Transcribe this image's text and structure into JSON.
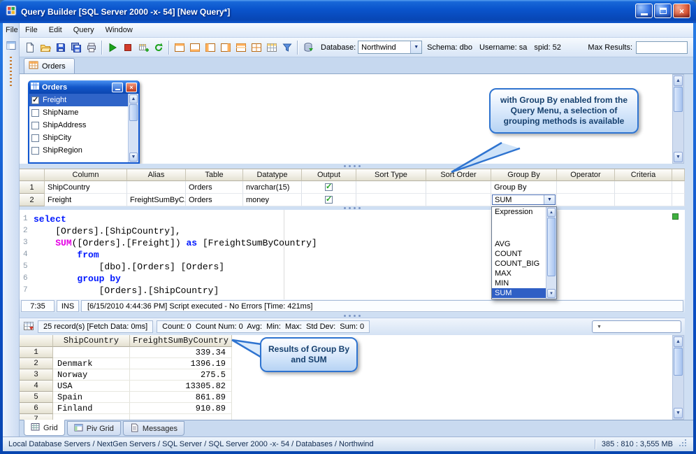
{
  "window": {
    "title": "Query Builder [SQL Server 2000 -x- 54] [New Query*]"
  },
  "parent_menu": {
    "clipped_file_label": "File"
  },
  "menu_bar": {
    "items": [
      "File",
      "Edit",
      "Query",
      "Window"
    ]
  },
  "toolbar": {
    "database_label": "Database:",
    "database_value": "Northwind",
    "schema_label": "Schema:",
    "schema_value": "dbo",
    "username_label": "Username:",
    "username_value": "sa",
    "spid_label": "spid:",
    "spid_value": "52",
    "max_results_label": "Max Results:",
    "max_results_value": ""
  },
  "document_tabs": {
    "active_label": "Orders"
  },
  "diagram": {
    "table_window": {
      "title": "Orders",
      "fields": [
        {
          "name": "Freight",
          "checked": true,
          "selected": true
        },
        {
          "name": "ShipName",
          "checked": false,
          "selected": false
        },
        {
          "name": "ShipAddress",
          "checked": false,
          "selected": false
        },
        {
          "name": "ShipCity",
          "checked": false,
          "selected": false
        },
        {
          "name": "ShipRegion",
          "checked": false,
          "selected": false
        }
      ]
    },
    "callout": "with Group By enabled from the Query Menu, a selection of grouping methods is available"
  },
  "columns_grid": {
    "headers": [
      "Column",
      "Alias",
      "Table",
      "Datatype",
      "Output",
      "Sort Type",
      "Sort Order",
      "Group By",
      "Operator",
      "Criteria"
    ],
    "rows": [
      {
        "num": "1",
        "column": "ShipCountry",
        "alias": "",
        "table": "Orders",
        "datatype": "nvarchar(15)",
        "output_checked": true,
        "sort_type": "",
        "sort_order": "",
        "group_by": "Group By",
        "operator": "",
        "criteria": ""
      },
      {
        "num": "2",
        "column": "Freight",
        "alias": "FreightSumByC...",
        "table": "Orders",
        "datatype": "money",
        "output_checked": true,
        "sort_type": "",
        "sort_order": "",
        "group_by": "SUM",
        "operator": "",
        "criteria": ""
      }
    ],
    "group_by_dropdown": {
      "items": [
        "Expression",
        "",
        "AVG",
        "COUNT",
        "COUNT_BIG",
        "MAX",
        "MIN",
        "SUM"
      ],
      "selected": "SUM"
    }
  },
  "sql_editor": {
    "lines": [
      {
        "num": "1",
        "segments": [
          {
            "t": "select",
            "s": "kw"
          }
        ]
      },
      {
        "num": "2",
        "segments": [
          {
            "t": "    [Orders].[ShipCountry],",
            "s": "pl"
          }
        ]
      },
      {
        "num": "3",
        "segments": [
          {
            "t": "    ",
            "s": "pl"
          },
          {
            "t": "SUM",
            "s": "fn"
          },
          {
            "t": "([Orders].[Freight]) ",
            "s": "pl"
          },
          {
            "t": "as",
            "s": "kw"
          },
          {
            "t": " [FreightSumByCountry]",
            "s": "pl"
          }
        ]
      },
      {
        "num": "4",
        "segments": [
          {
            "t": "        ",
            "s": "pl"
          },
          {
            "t": "from",
            "s": "kw"
          }
        ]
      },
      {
        "num": "5",
        "segments": [
          {
            "t": "            [dbo].[Orders] [Orders]",
            "s": "pl"
          }
        ]
      },
      {
        "num": "6",
        "segments": [
          {
            "t": "        ",
            "s": "pl"
          },
          {
            "t": "group by",
            "s": "kw"
          }
        ]
      },
      {
        "num": "7",
        "segments": [
          {
            "t": "            [Orders].[ShipCountry]",
            "s": "pl"
          }
        ]
      }
    ]
  },
  "editor_status": {
    "cursor": "7:35",
    "mode": "INS",
    "message": "[6/15/2010 4:44:36 PM] Script executed - No Errors [Time: 421ms]"
  },
  "results": {
    "records_info": "25 record(s) [Fetch Data: 0ms]",
    "stats": "Count: 0  Count Num: 0  Avg:  Min:  Max:  Std Dev:  Sum: 0",
    "grid": {
      "headers": [
        "ShipCountry",
        "FreightSumByCountry"
      ],
      "rows": [
        {
          "num": "1",
          "country": "",
          "value": "339.34"
        },
        {
          "num": "2",
          "country": "Denmark",
          "value": "1396.19"
        },
        {
          "num": "3",
          "country": "Norway",
          "value": "275.5"
        },
        {
          "num": "4",
          "country": "USA",
          "value": "13305.82"
        },
        {
          "num": "5",
          "country": "Spain",
          "value": "861.89"
        },
        {
          "num": "6",
          "country": "Finland",
          "value": "910.89"
        },
        {
          "num": "7",
          "country": "",
          "value": ""
        }
      ]
    },
    "callout": "Results of Group By and SUM",
    "tabs": [
      {
        "label": "Grid",
        "active": true
      },
      {
        "label": "Piv Grid",
        "active": false
      },
      {
        "label": "Messages",
        "active": false
      }
    ]
  },
  "status_bar": {
    "path": "Local Database Servers / NextGen Servers / SQL Server / SQL Server 2000 -x- 54 / Databases / Northwind",
    "memory": "385 : 810 : 3,555 MB"
  }
}
